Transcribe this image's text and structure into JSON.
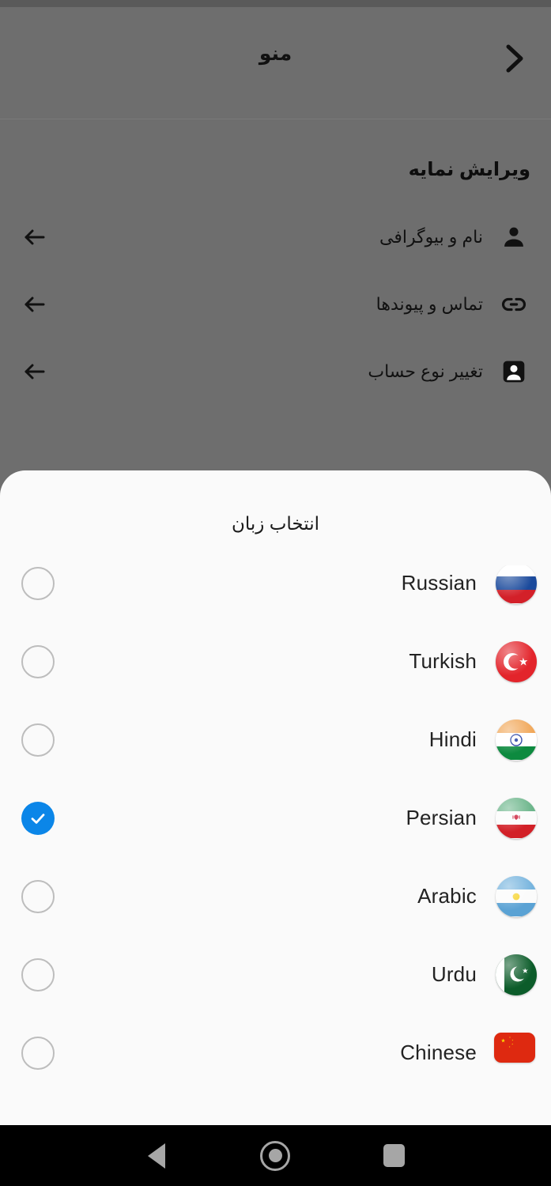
{
  "app_bar": {
    "title": "منو",
    "back_icon": "chevron-right-icon"
  },
  "background_screen": {
    "section_title": "ویرایش نمایه",
    "items": [
      {
        "label": "نام و بیوگرافی",
        "icon": "person-icon",
        "arrow_icon": "arrow-left-icon"
      },
      {
        "label": "تماس و پیوندها",
        "icon": "link-icon",
        "arrow_icon": "arrow-left-icon"
      },
      {
        "label": "تغییر نوع حساب",
        "icon": "account-box-icon",
        "arrow_icon": "arrow-left-icon"
      }
    ]
  },
  "language_sheet": {
    "title": "انتخاب زبان",
    "selected": "Persian",
    "accent_color": "#0b86e8",
    "background_color": "#fafafa",
    "options": [
      {
        "label": "Russian",
        "flag": "flag-russia-icon",
        "selected": false
      },
      {
        "label": "Turkish",
        "flag": "flag-turkey-icon",
        "selected": false
      },
      {
        "label": "Hindi",
        "flag": "flag-india-icon",
        "selected": false
      },
      {
        "label": "Persian",
        "flag": "flag-iran-icon",
        "selected": true
      },
      {
        "label": "Arabic",
        "flag": "flag-argentina-icon",
        "selected": false
      },
      {
        "label": "Urdu",
        "flag": "flag-pakistan-icon",
        "selected": false
      },
      {
        "label": "Chinese",
        "flag": "flag-china-icon",
        "selected": false
      }
    ]
  },
  "nav_bar": {
    "back_label": "back-triangle-icon",
    "home_label": "home-circle-icon",
    "recents_label": "recents-square-icon"
  }
}
